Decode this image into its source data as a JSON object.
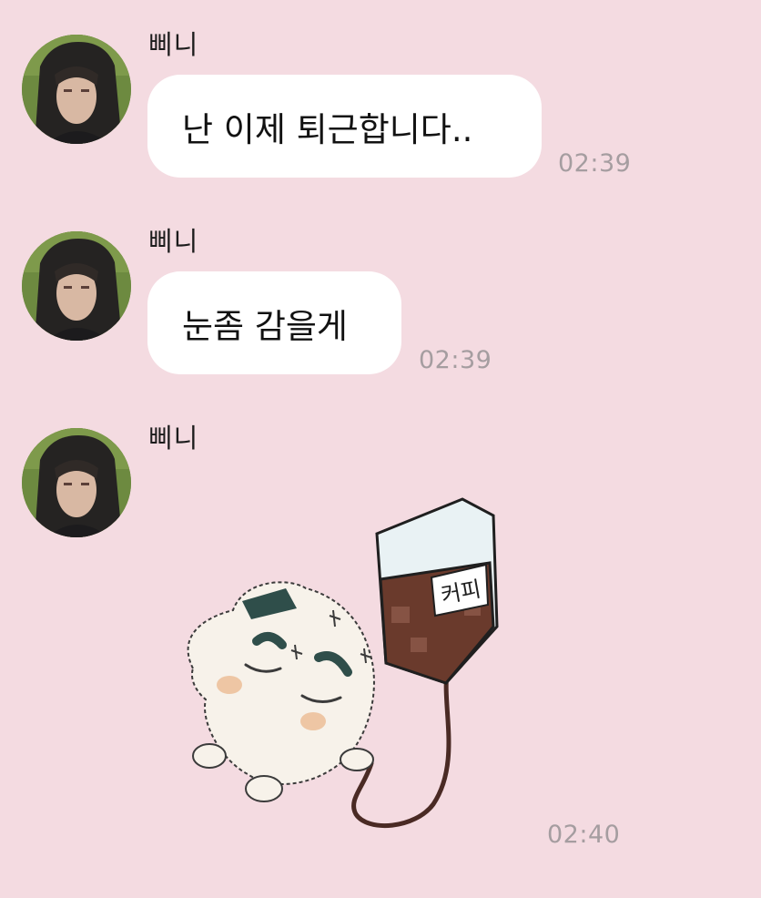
{
  "conversation": {
    "messages": [
      {
        "sender": "삐니",
        "text": "난 이제 퇴근합니다..",
        "time": "02:39",
        "avatar_icon": "profile-photo-avatar"
      },
      {
        "sender": "삐니",
        "text": "눈좀 감을게",
        "time": "02:39",
        "avatar_icon": "profile-photo-avatar"
      },
      {
        "sender": "삐니",
        "sticker": {
          "icon": "rice-ball-coffee-iv-sticker",
          "label": "커피"
        },
        "time": "02:40",
        "avatar_icon": "profile-photo-avatar"
      }
    ]
  },
  "colors": {
    "background": "#f4dbe1",
    "bubble": "#ffffff",
    "timestamp": "#a59da0"
  }
}
